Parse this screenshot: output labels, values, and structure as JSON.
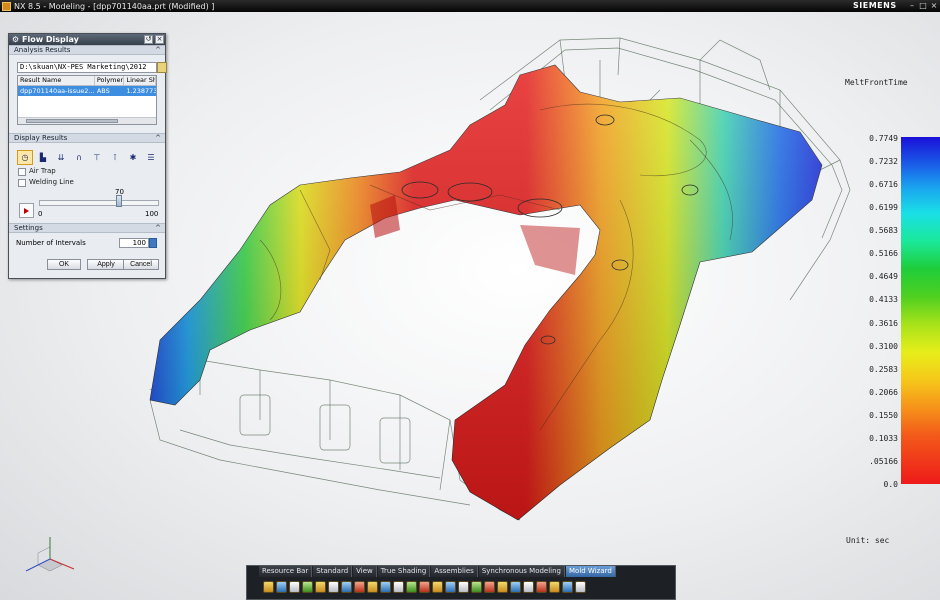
{
  "window": {
    "title": "NX 8.5 - Modeling - [dpp701140aa.prt (Modified) ]",
    "brand": "SIEMENS",
    "controls": [
      "–",
      "□",
      "×"
    ]
  },
  "dialog": {
    "title": "Flow Display",
    "analysis_results": {
      "header": "Analysis Results",
      "path": "D:\\skuan\\NX-PES Marketing\\2012",
      "columns": [
        "Result Name",
        "Polymer",
        "Linear Sh"
      ],
      "rows": [
        {
          "name": "dpp701140aa-issue2...",
          "polymer": "ABS",
          "linear": "1.238773"
        }
      ]
    },
    "display_results": {
      "header": "Display Results",
      "air_trap_label": "Air Trap",
      "air_trap_checked": false,
      "welding_line_label": "Welding Line",
      "welding_line_checked": false,
      "slider": {
        "value": "70",
        "min": "0",
        "max": "100",
        "fraction": 0.7
      }
    },
    "settings": {
      "header": "Settings",
      "intervals_label": "Number of Intervals",
      "intervals_value": "100"
    },
    "buttons": {
      "ok": "OK",
      "apply": "Apply",
      "cancel": "Cancel"
    }
  },
  "legend": {
    "title": "MeltFrontTime",
    "ticks": [
      "0.7749",
      "0.7232",
      "0.6716",
      "0.6199",
      "0.5683",
      "0.5166",
      "0.4649",
      "0.4133",
      "0.3616",
      "0.3100",
      "0.2583",
      "0.2066",
      "0.1550",
      "0.1033",
      ".05166",
      "0.0"
    ],
    "units": "Unit: sec",
    "colors": {
      "max": "#1a10d8",
      "mid": "#1fcd3a",
      "min": "#ee1a1a"
    }
  },
  "toolbar": {
    "tabs": [
      "Resource Bar",
      "Standard",
      "View",
      "True Shading",
      "Assemblies",
      "Synchronous Modeling",
      "Mold Wizard"
    ],
    "active_tab": "Mold Wizard"
  }
}
